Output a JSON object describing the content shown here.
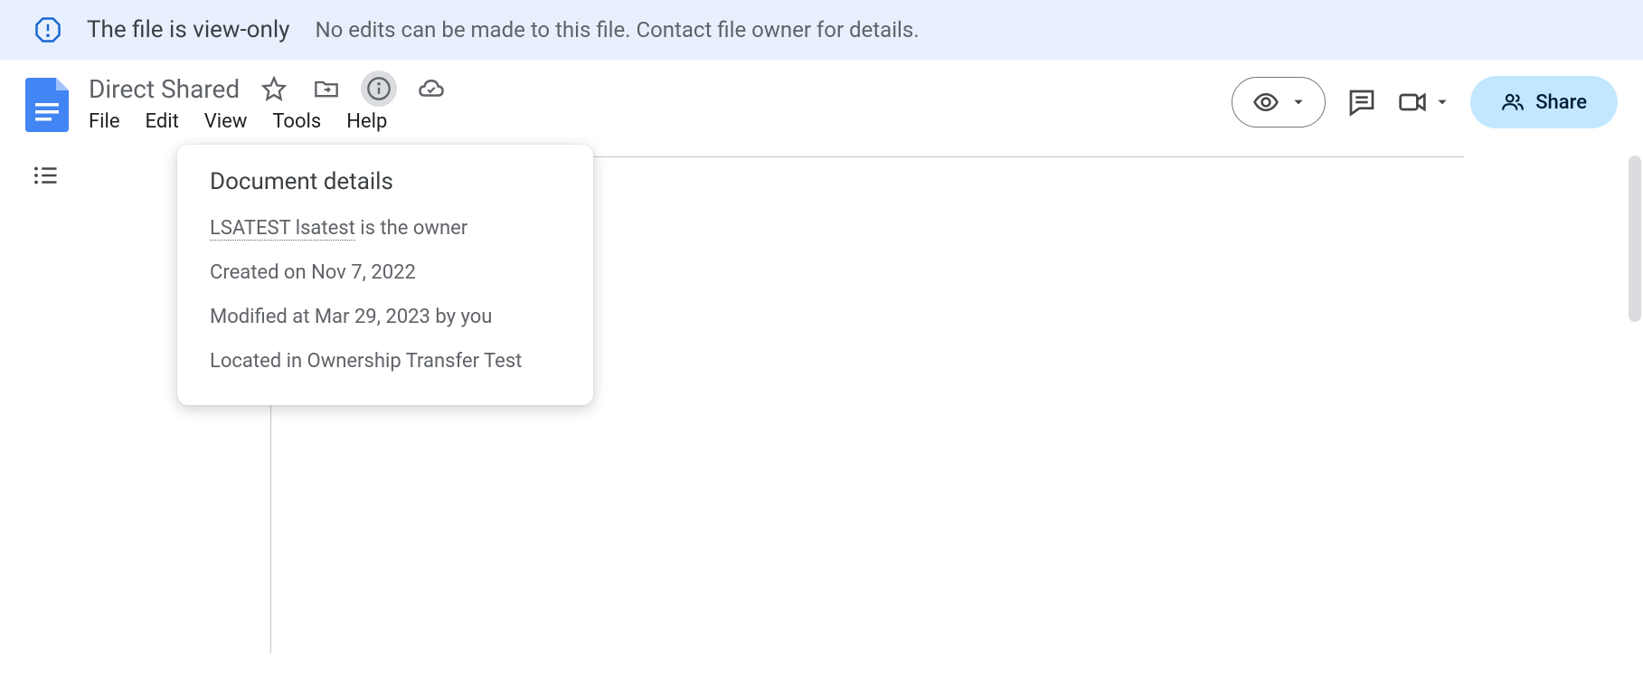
{
  "banner": {
    "title": "The file is view-only",
    "subtitle": "No edits can be made to this file. Contact file owner for details."
  },
  "header": {
    "title": "Direct Shared",
    "menus": [
      "File",
      "Edit",
      "View",
      "Tools",
      "Help"
    ],
    "share_label": "Share"
  },
  "popup": {
    "title": "Document details",
    "owner_name": "LSATEST lsatest",
    "owner_suffix": " is the owner",
    "created": "Created on Nov 7, 2022",
    "modified": "Modified at Mar 29, 2023 by you",
    "located": "Located in Ownership Transfer Test"
  }
}
